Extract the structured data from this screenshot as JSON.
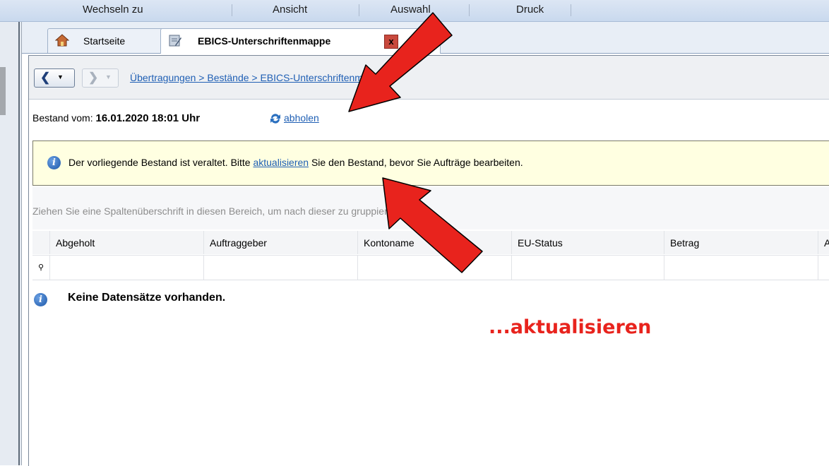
{
  "menu": {
    "items": [
      {
        "label": "Wechseln zu"
      },
      {
        "label": "Ansicht"
      },
      {
        "label": "Auswahl"
      },
      {
        "label": "Druck"
      }
    ]
  },
  "tabs": [
    {
      "label": "Startseite",
      "icon": "home-icon"
    },
    {
      "label": "EBICS-Unterschriftenmappe",
      "icon": "signature-folder-icon",
      "close_label": "x"
    }
  ],
  "nav": {
    "breadcrumb": "Übertragungen > Bestände > EBICS-Unterschriftenmappe"
  },
  "bestand": {
    "label": "Bestand vom:",
    "datetime": "16.01.2020 18:01 Uhr",
    "fetch_link": "abholen"
  },
  "alert": {
    "text_before": "Der vorliegende Bestand ist veraltet. Bitte ",
    "link": "aktualisieren",
    "text_after": " Sie den Bestand, bevor Sie Aufträge bearbeiten."
  },
  "grid": {
    "group_hint": "Ziehen Sie eine Spaltenüberschrift in diesen Bereich, um nach dieser zu gruppieren",
    "columns": [
      "Abgeholt",
      "Auftraggeber",
      "Kontoname",
      "EU-Status",
      "Betrag",
      "A"
    ],
    "empty_message": "Keine Datensätze vorhanden."
  },
  "annotation": {
    "text": "...aktualisieren",
    "color": "#e8231d"
  }
}
